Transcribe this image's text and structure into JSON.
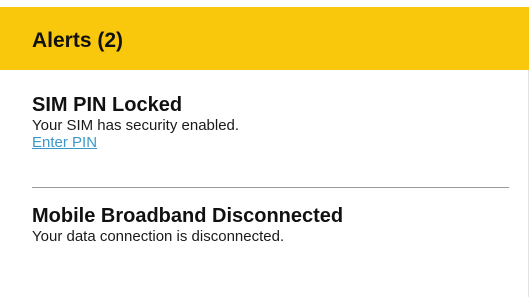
{
  "header": {
    "title": "Alerts (2)"
  },
  "alerts": [
    {
      "title": "SIM PIN Locked",
      "message": "Your SIM has security enabled.",
      "link_label": "Enter PIN"
    },
    {
      "title": "Mobile Broadband Disconnected",
      "message": "Your data connection is disconnected."
    }
  ],
  "colors": {
    "header_bg": "#f9c80c",
    "link": "#3b98c9",
    "divider": "#999999"
  }
}
